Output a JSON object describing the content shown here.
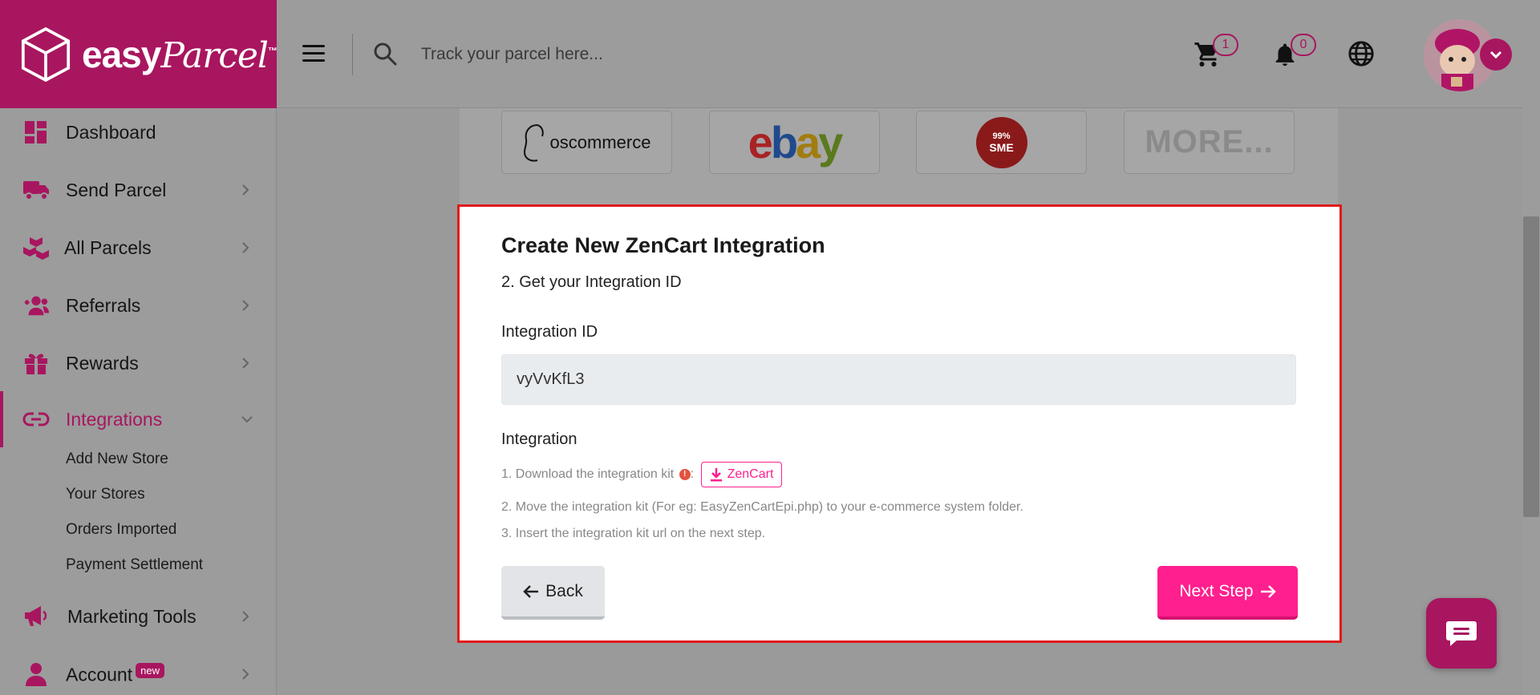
{
  "header": {
    "logo_text": "easy",
    "logo_script": "Parcel",
    "logo_tm": "™",
    "search_placeholder": "Track your parcel here...",
    "cart_count": "1",
    "notification_count": "0"
  },
  "sidebar": {
    "items": [
      {
        "label": "Dashboard",
        "icon": "dashboard-icon"
      },
      {
        "label": "Send Parcel",
        "icon": "truck-icon"
      },
      {
        "label": "All Parcels",
        "icon": "boxes-icon"
      },
      {
        "label": "Referrals",
        "icon": "add-user-icon"
      },
      {
        "label": "Rewards",
        "icon": "gift-icon"
      },
      {
        "label": "Integrations",
        "icon": "link-icon"
      },
      {
        "label": "Marketing Tools",
        "icon": "megaphone-icon"
      },
      {
        "label": "Account",
        "icon": "user-icon",
        "badge": "new"
      }
    ],
    "integrations_sub": [
      "Add New Store",
      "Your Stores",
      "Orders Imported",
      "Payment Settlement"
    ]
  },
  "platforms": {
    "oscommerce": "oscommerce",
    "ebay_e": "e",
    "ebay_b": "b",
    "ebay_a": "a",
    "ebay_y": "y",
    "sme_top": "99%",
    "sme_bottom": "SME",
    "more": "MORE..."
  },
  "modal": {
    "title": "Create New ZenCart Integration",
    "step": "2. Get your Integration ID",
    "integration_id_label": "Integration ID",
    "integration_id_value": "vyVvKfL3",
    "integration_label": "Integration",
    "kit_step1": "1. Download the integration kit",
    "kit_step1_sep": ":",
    "zencart_button": "ZenCart",
    "kit_step2": "2. Move the integration kit (For eg: EasyZenCartEpi.php) to your e-commerce system folder.",
    "kit_step3": "3. Insert the integration kit url on the next step.",
    "back_button": "Back",
    "next_button": "Next Step"
  },
  "colors": {
    "brand": "#a8165f",
    "accent": "#ff1f8e",
    "highlight_border": "#e01b1b"
  }
}
